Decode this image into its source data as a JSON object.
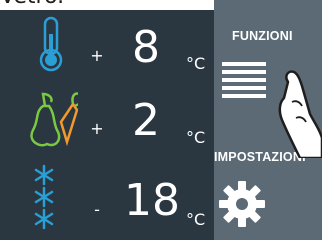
{
  "header": {
    "partial_text": "Vetro."
  },
  "zones": [
    {
      "name_icon": "thermometer-icon",
      "sign": "+",
      "value": "8",
      "unit": "°C"
    },
    {
      "name_icon": "fruit-vegetable-icon",
      "sign": "+",
      "value": "2",
      "unit": "°C"
    },
    {
      "name_icon": "snowflakes-icon",
      "sign": "-",
      "value": "18",
      "unit": "°C"
    }
  ],
  "side_menu": {
    "functions_label": "FUNZIONI",
    "settings_label": "IMPOSTAZIONI"
  },
  "colors": {
    "panel": "#2a3640",
    "sidebar": "#5c6a75",
    "thermo_icon": "#2a9fd6",
    "fruit_icon": "#7ac943",
    "carrot_icon": "#f39a2d",
    "snow_icon": "#2a9fd6"
  }
}
